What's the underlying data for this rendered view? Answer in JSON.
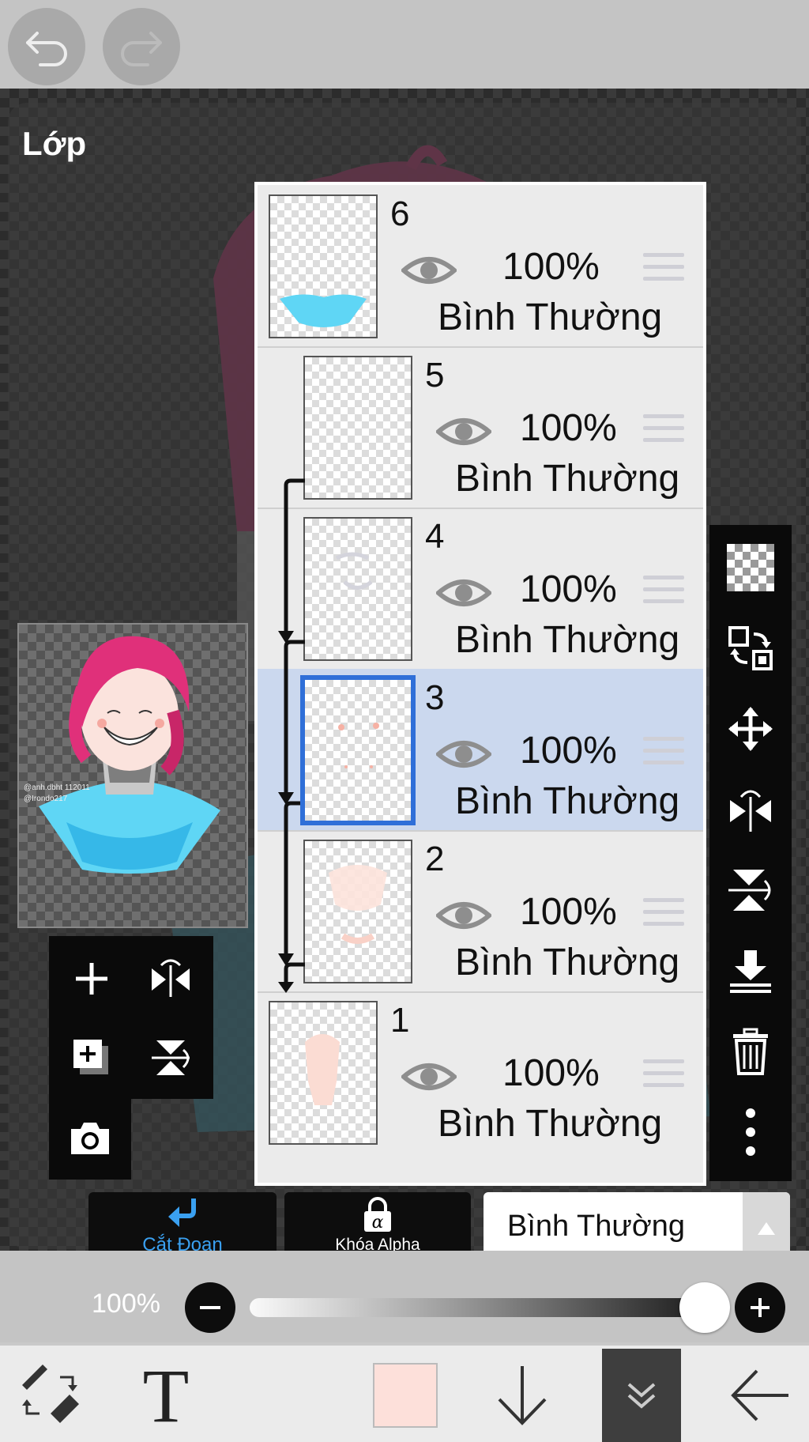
{
  "panel": {
    "title": "Lớp"
  },
  "layers": [
    {
      "number": "6",
      "opacity": "100%",
      "blend": "Bình Thường"
    },
    {
      "number": "5",
      "opacity": "100%",
      "blend": "Bình Thường"
    },
    {
      "number": "4",
      "opacity": "100%",
      "blend": "Bình Thường"
    },
    {
      "number": "3",
      "opacity": "100%",
      "blend": "Bình Thường"
    },
    {
      "number": "2",
      "opacity": "100%",
      "blend": "Bình Thường"
    },
    {
      "number": "1",
      "opacity": "100%",
      "blend": "Bình Thường"
    }
  ],
  "selected_layer": "3",
  "preview": {
    "watermark_line1": "@anh.dbht 112011",
    "watermark_line2": "@Irondo217"
  },
  "mode_buttons": {
    "clipping": "Cắt Đoạn",
    "alpha_lock": "Khóa Alpha"
  },
  "blend_select": {
    "value": "Bình Thường"
  },
  "opacity_slider": {
    "label": "100%",
    "value": 1.0
  },
  "colors": {
    "accent": "#2f6fd8",
    "selected_row": "#cbd8ee",
    "current_color": "#fde0da",
    "clip_blue": "#3aa0f0"
  },
  "icons": {
    "top": [
      "undo-icon",
      "redo-icon"
    ],
    "right_toolbar": [
      "transparency-icon",
      "swap-layer-icon",
      "move-icon",
      "flip-horizontal-icon",
      "flip-vertical-icon",
      "merge-down-icon",
      "trash-icon",
      "more-icon"
    ],
    "left_tools": [
      "add-layer-icon",
      "flip-layer-icon",
      "duplicate-layer-icon",
      "rotate-layer-icon",
      "camera-icon"
    ],
    "bottom_bar": [
      "brush-eraser-icon",
      "text-icon",
      "color-swatch",
      "arrow-down-icon",
      "double-chevron-icon",
      "back-icon"
    ]
  }
}
